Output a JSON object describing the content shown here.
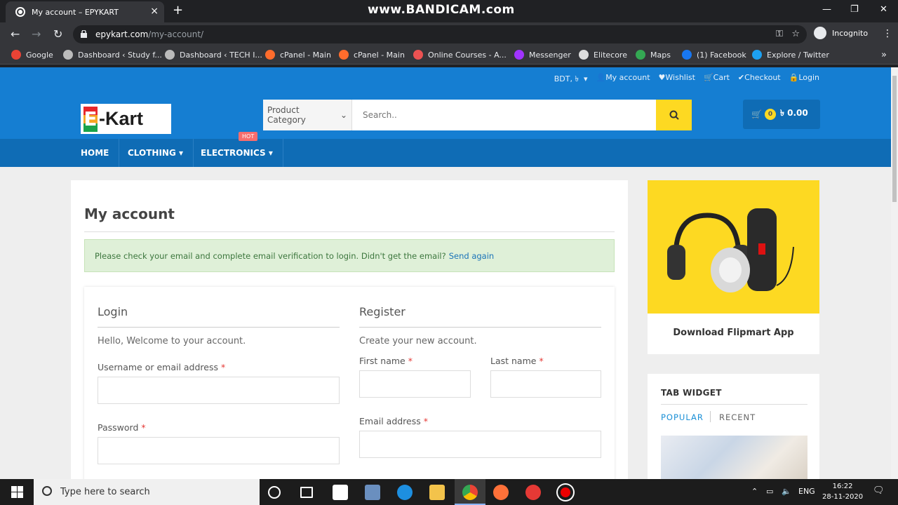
{
  "browser": {
    "tab_title": "My account – EPYKART",
    "watermark": "www.BANDICAM.com",
    "url_domain": "epykart.com",
    "url_path": "/my-account/",
    "incognito_label": "Incognito",
    "bookmarks": [
      {
        "label": "Google",
        "color": "#ea4335"
      },
      {
        "label": "Dashboard ‹ Study f...",
        "color": "#bbbbbb"
      },
      {
        "label": "Dashboard ‹ TECH I...",
        "color": "#bbbbbb"
      },
      {
        "label": "cPanel - Main",
        "color": "#ff6c2c"
      },
      {
        "label": "cPanel - Main",
        "color": "#ff6c2c"
      },
      {
        "label": "Online Courses - A...",
        "color": "#ec5252"
      },
      {
        "label": "Messenger",
        "color": "#a033ff"
      },
      {
        "label": "Elitecore",
        "color": "#dddddd"
      },
      {
        "label": "Maps",
        "color": "#34a853"
      },
      {
        "label": "(1) Facebook",
        "color": "#1877f2"
      },
      {
        "label": "Explore / Twitter",
        "color": "#1da1f2"
      }
    ]
  },
  "site": {
    "currency": "BDT, ৳",
    "top_links": [
      "My account",
      "Wishlist",
      "Cart",
      "Checkout",
      "Login"
    ],
    "logo_e": "E",
    "logo_text": "-Kart",
    "category_label": "Product Category",
    "search_placeholder": "Search..",
    "cart_count": "0",
    "cart_total": "৳ 0.00",
    "nav": [
      "HOME",
      "CLOTHING",
      "ELECTRONICS"
    ],
    "hot_badge": "HOT",
    "brand_color": "#157ed2",
    "accent_color": "#fdd922"
  },
  "main": {
    "title": "My account",
    "notice_text": "Please check your email and complete email verification to login. Didn't get the email?",
    "notice_link": "Send again",
    "login": {
      "heading": "Login",
      "welcome": "Hello, Welcome to your account.",
      "username_label": "Username or email address",
      "password_label": "Password",
      "required_mark": "*"
    },
    "register": {
      "heading": "Register",
      "subtitle": "Create your new account.",
      "first_name_label": "First name",
      "last_name_label": "Last name",
      "email_label": "Email address"
    }
  },
  "sidebar": {
    "ad_text": "Download Flipmart App",
    "tab_widget_title": "TAB WIDGET",
    "tabs": [
      "POPULAR",
      "RECENT"
    ]
  },
  "taskbar": {
    "search_placeholder": "Type here to search",
    "language": "ENG",
    "time": "16:22",
    "date": "28-11-2020"
  }
}
